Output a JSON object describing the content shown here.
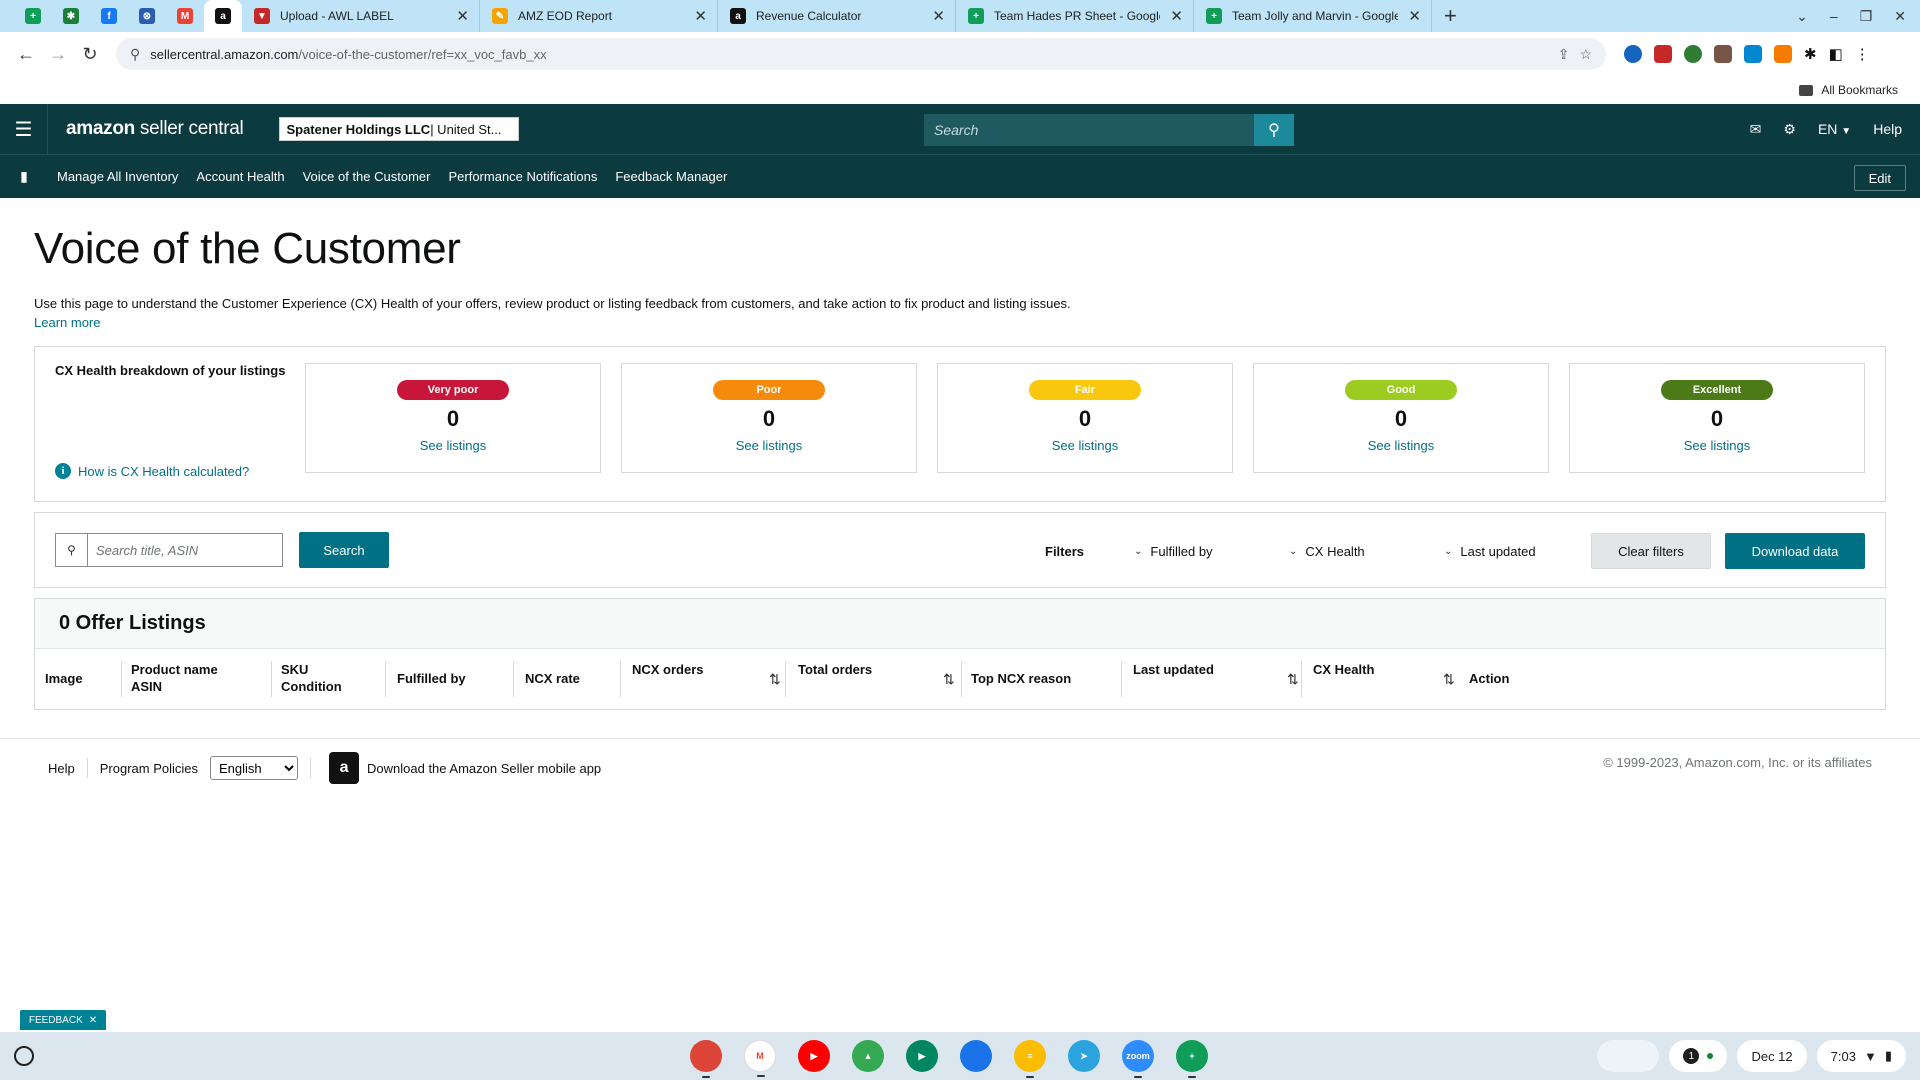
{
  "browser": {
    "pinned_tabs": [
      {
        "name": "sheets-pinned-tab",
        "color": "#0f9d58",
        "glyph": "+"
      },
      {
        "name": "puzzle-pinned-tab",
        "color": "#1a7f37",
        "glyph": "✱"
      },
      {
        "name": "facebook-pinned-tab",
        "color": "#1877f2",
        "glyph": "f"
      },
      {
        "name": "globe-pinned-tab",
        "color": "#2a5db0",
        "glyph": "⊗"
      },
      {
        "name": "gmail-pinned-tab",
        "color": "#ea4335",
        "glyph": "M"
      },
      {
        "name": "amazon-pinned-tab",
        "color": "#111111",
        "glyph": "a"
      }
    ],
    "tabs": [
      {
        "title": "Upload - AWL LABEL",
        "icon_color": "#c62828",
        "glyph": "▼"
      },
      {
        "title": "AMZ EOD Report",
        "icon_color": "#f4a300",
        "glyph": "✎"
      },
      {
        "title": "Revenue Calculator",
        "icon_color": "#111111",
        "glyph": "a"
      },
      {
        "title": "Team Hades PR Sheet - Google",
        "icon_color": "#0f9d58",
        "glyph": "+"
      },
      {
        "title": "Team Jolly and Marvin - Google",
        "icon_color": "#0f9d58",
        "glyph": "+"
      }
    ],
    "url_host": "sellercentral.amazon.com",
    "url_path": "/voice-of-the-customer/ref=xx_voc_favb_xx",
    "bookmarks_label": "All Bookmarks"
  },
  "header": {
    "logo_brand": "amazon",
    "logo_suffix": " seller central",
    "account_name": "Spatener Holdings LLC",
    "account_region": " | United St...",
    "search_placeholder": "Search",
    "language": "EN",
    "help": "Help"
  },
  "nav": {
    "items": [
      "Manage All Inventory",
      "Account Health",
      "Voice of the Customer",
      "Performance Notifications",
      "Feedback Manager"
    ],
    "edit": "Edit"
  },
  "page": {
    "title": "Voice of the Customer",
    "intro": "Use this page to understand the Customer Experience (CX) Health of your offers, review product or listing feedback from customers, and take action to fix product and listing issues.",
    "learn_more": "Learn more"
  },
  "cx_health": {
    "heading": "CX Health breakdown of your listings",
    "how_link": "How is CX Health calculated?",
    "cards": [
      {
        "label": "Very poor",
        "count": "0",
        "link": "See listings",
        "color": "#c7163a"
      },
      {
        "label": "Poor",
        "count": "0",
        "link": "See listings",
        "color": "#f68a0b"
      },
      {
        "label": "Fair",
        "count": "0",
        "link": "See listings",
        "color": "#f9c80e"
      },
      {
        "label": "Good",
        "count": "0",
        "link": "See listings",
        "color": "#9ccc22"
      },
      {
        "label": "Excellent",
        "count": "0",
        "link": "See listings",
        "color": "#4c7a16"
      }
    ]
  },
  "filters": {
    "search_placeholder": "Search title, ASIN",
    "search_button": "Search",
    "filters_label": "Filters",
    "dropdowns": [
      "Fulfilled by",
      "CX Health",
      "Last updated"
    ],
    "clear": "Clear filters",
    "download": "Download data"
  },
  "offers": {
    "title": "0 Offer Listings",
    "columns": [
      {
        "line1": "Image",
        "line2": ""
      },
      {
        "line1": "Product name",
        "line2": "ASIN"
      },
      {
        "line1": "SKU",
        "line2": "Condition"
      },
      {
        "line1": "Fulfilled by",
        "line2": ""
      },
      {
        "line1": "NCX rate",
        "line2": ""
      },
      {
        "line1": "NCX orders",
        "line2": ""
      },
      {
        "line1": "Total orders",
        "line2": ""
      },
      {
        "line1": "Top NCX reason",
        "line2": ""
      },
      {
        "line1": "Last updated",
        "line2": ""
      },
      {
        "line1": "CX Health",
        "line2": ""
      },
      {
        "line1": "Action",
        "line2": ""
      }
    ]
  },
  "footer": {
    "help": "Help",
    "policies": "Program Policies",
    "language": "English",
    "mobile_app": "Download the Amazon Seller mobile app",
    "copyright": "© 1999-2023, Amazon.com, Inc. or its affiliates"
  },
  "feedback_tab": "FEEDBACK",
  "shelf": {
    "apps": [
      {
        "name": "chrome-app-icon",
        "color": "#db4437",
        "label": ""
      },
      {
        "name": "gmail-app-icon",
        "color": "#ffffff",
        "label": "M"
      },
      {
        "name": "youtube-app-icon",
        "color": "#ff0000",
        "label": "▶"
      },
      {
        "name": "drive-app-icon",
        "color": "#34a853",
        "label": "▲"
      },
      {
        "name": "play-store-app-icon",
        "color": "#01875f",
        "label": "▶"
      },
      {
        "name": "files-app-icon",
        "color": "#1a73e8",
        "label": ""
      },
      {
        "name": "keep-app-icon",
        "color": "#fbbc04",
        "label": "≡"
      },
      {
        "name": "telegram-app-icon",
        "color": "#2aa3df",
        "label": "➤"
      },
      {
        "name": "zoom-app-icon",
        "color": "#2d8cff",
        "label": "zoom"
      },
      {
        "name": "sheets-app-icon",
        "color": "#0f9d58",
        "label": "+"
      }
    ],
    "notifications": "1",
    "date": "Dec 12",
    "time": "7:03"
  }
}
